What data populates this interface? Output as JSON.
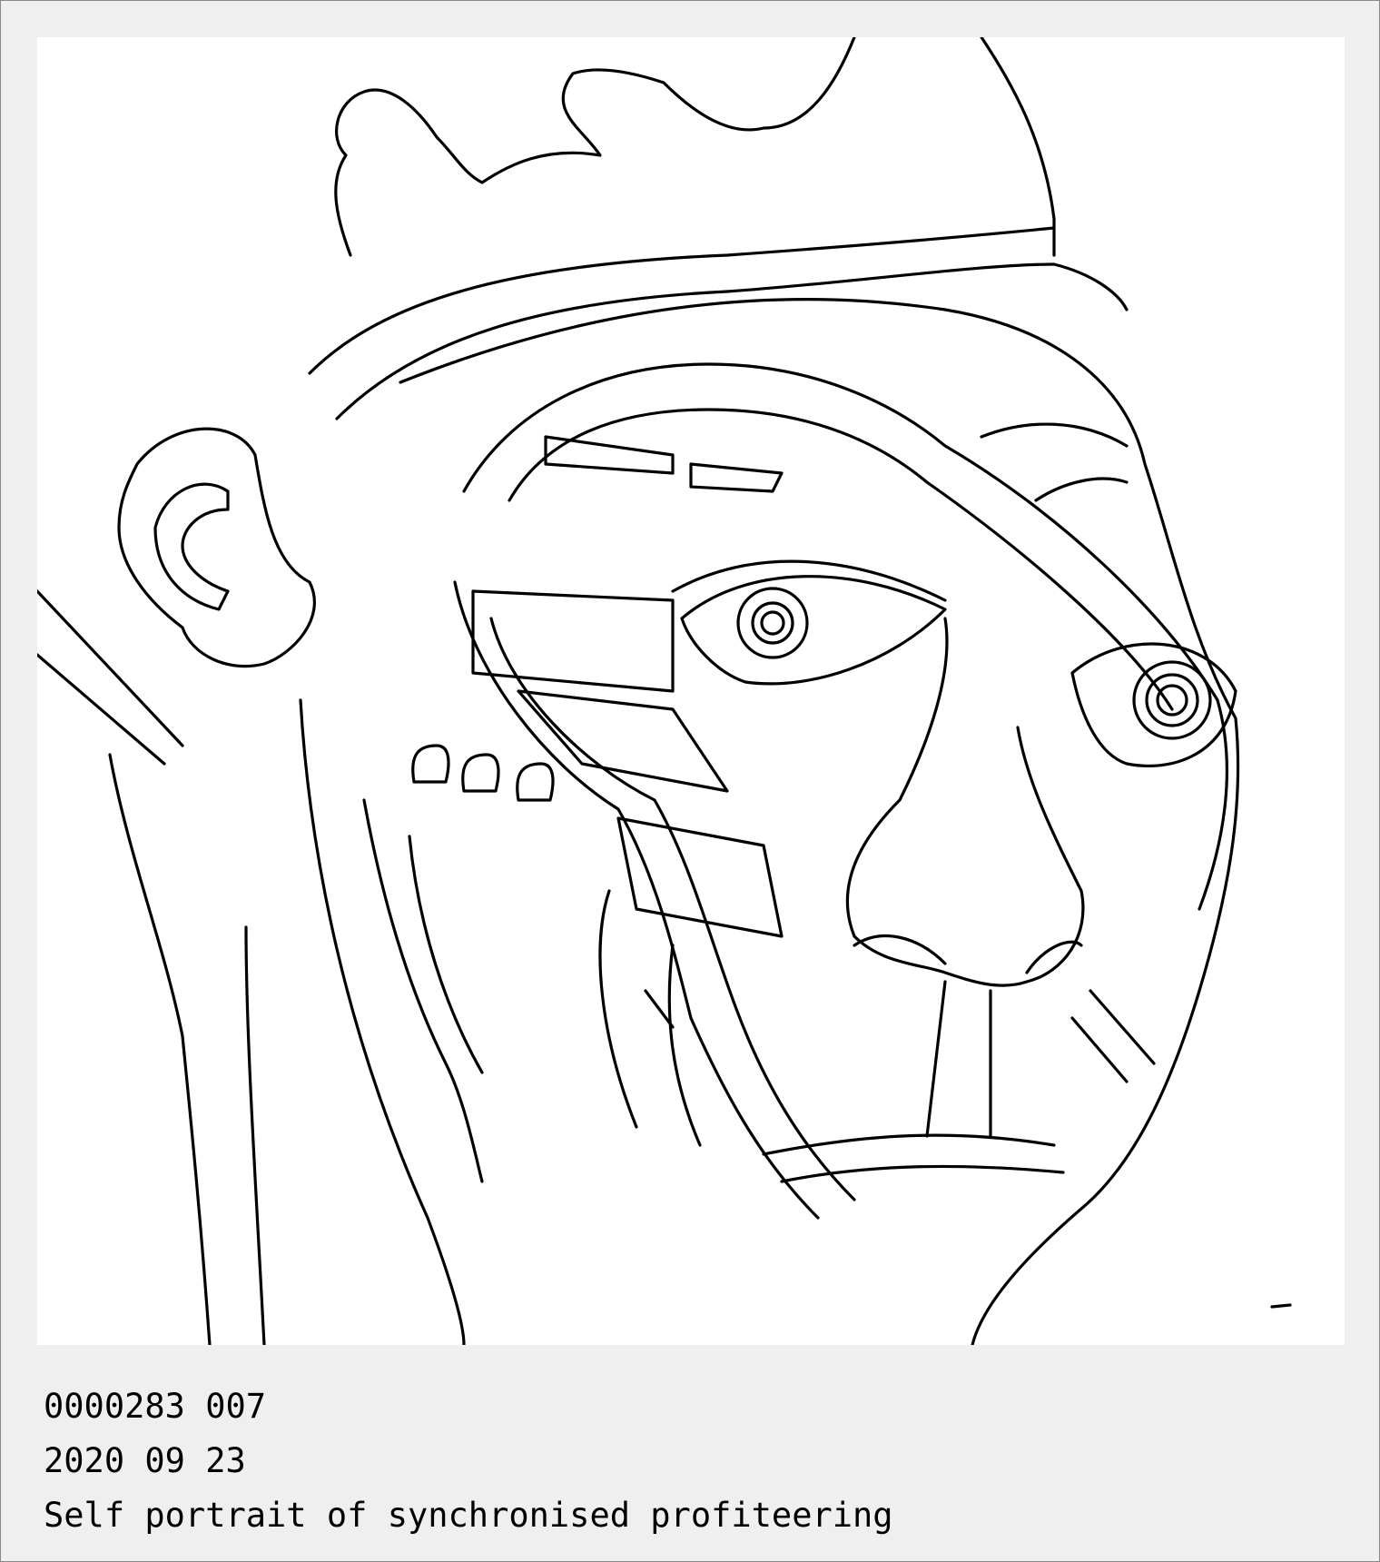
{
  "card": {
    "id_line": "0000283 007",
    "date_line": "2020 09 23",
    "title_line": "Self portrait of synchronised profiteering"
  },
  "artwork": {
    "style": "black line drawing on white",
    "stroke_color": "#000000",
    "background_color": "#ffffff",
    "frame_color": "#efefef"
  }
}
